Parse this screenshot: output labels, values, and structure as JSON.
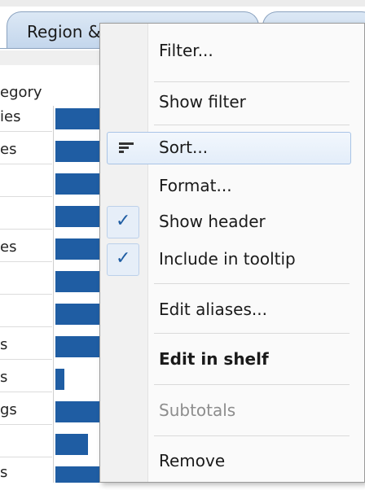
{
  "tabs": {
    "active_label": "Region &"
  },
  "table": {
    "header": "egory",
    "rows": [
      {
        "label": "ies",
        "value": 1.0
      },
      {
        "label": "es",
        "value": 1.0
      },
      {
        "label": "",
        "value": 1.0
      },
      {
        "label": "",
        "value": 1.0
      },
      {
        "label": "es",
        "value": 1.0
      },
      {
        "label": "",
        "value": 1.0
      },
      {
        "label": "",
        "value": 1.0
      },
      {
        "label": "s",
        "value": 1.0
      },
      {
        "label": "s",
        "value": 0.2
      },
      {
        "label": "gs",
        "value": 1.0
      },
      {
        "label": "",
        "value": 0.74
      },
      {
        "label": "s",
        "value": 1.0
      }
    ]
  },
  "menu": {
    "items": [
      {
        "label": "Filter..."
      },
      {
        "label": "Show filter"
      },
      {
        "label": "Sort...",
        "icon": "sort-icon",
        "highlighted": true
      },
      {
        "label": "Format..."
      },
      {
        "label": "Show header",
        "checked": true
      },
      {
        "label": "Include in tooltip",
        "checked": true
      },
      {
        "label": "Edit aliases..."
      },
      {
        "label": "Edit in shelf",
        "bold": true
      },
      {
        "label": "Subtotals",
        "disabled": true
      },
      {
        "label": "Remove"
      }
    ],
    "check_glyph": "✓"
  },
  "colors": {
    "bar": "#1f5da3",
    "highlight_border": "#a9c4e6"
  }
}
